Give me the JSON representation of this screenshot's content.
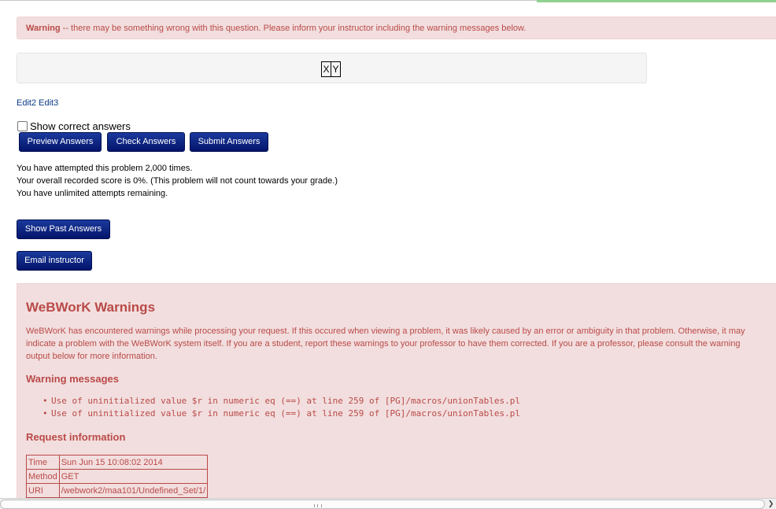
{
  "warning": {
    "bold": "Warning",
    "text": " -- there may be something wrong with this question. Please inform your instructor including the warning messages below."
  },
  "problem": {
    "cells": [
      "X",
      "Y"
    ]
  },
  "edit_links": [
    "Edit2",
    "Edit3"
  ],
  "show_correct_label": "Show correct answers",
  "buttons": {
    "preview": "Preview Answers",
    "check": "Check Answers",
    "submit": "Submit Answers",
    "past": "Show Past Answers",
    "email": "Email instructor"
  },
  "attempts": [
    "You have attempted this problem 2,000 times.",
    "Your overall recorded score is 0%. (This problem will not count towards your grade.)",
    "You have unlimited attempts remaining."
  ],
  "webwork_warnings": {
    "title": "WeBWorK Warnings",
    "description": "WeBWorK has encountered warnings while processing your request. If this occured when viewing a problem, it was likely caused by an error or ambiguity in that problem. Otherwise, it may indicate a problem with the WeBWorK system itself. If you are a student, report these warnings to your professor to have them corrected. If you are a professor, please consult the warning output below for more information.",
    "messages_heading": "Warning messages",
    "messages": [
      "Use of uninitialized value $r in numeric eq (==) at line 259 of [PG]/macros/unionTables.pl",
      "Use of uninitialized value $r in numeric eq (==) at line 259 of [PG]/macros/unionTables.pl"
    ],
    "request_heading": "Request information",
    "request": [
      {
        "key": "Time",
        "value": "Sun Jun 15 10:08:02 2014"
      },
      {
        "key": "Method",
        "value": "GET"
      },
      {
        "key": "URI",
        "value": "/webwork2/maa101/Undefined_Set/1/"
      }
    ]
  },
  "colors": {
    "alert_bg": "#f2dede",
    "alert_text": "#b94a48",
    "button_bg": "#03146b",
    "link": "#0a3a85"
  }
}
